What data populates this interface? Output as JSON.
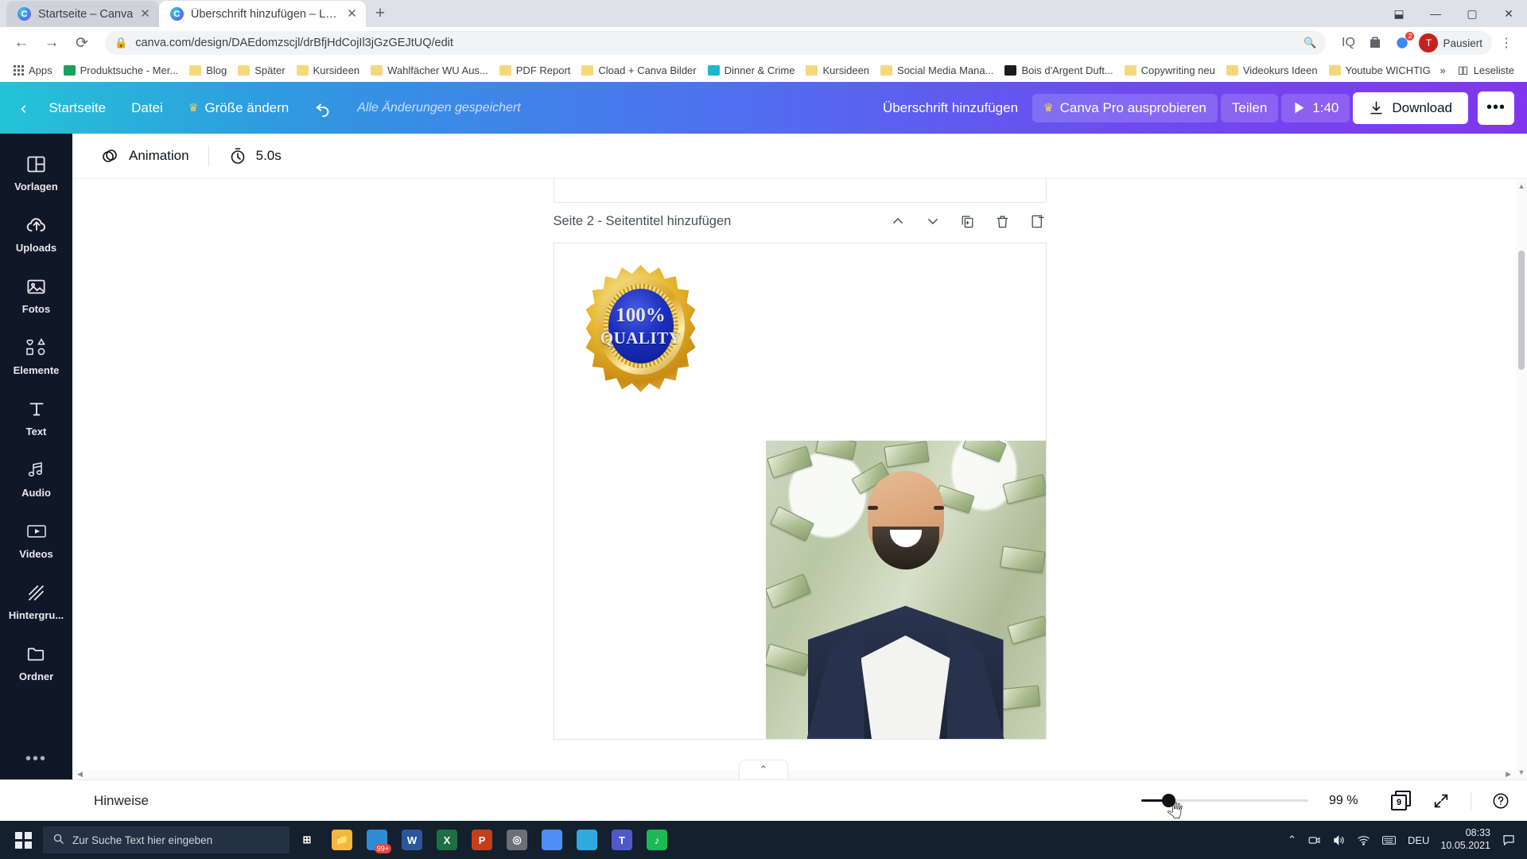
{
  "browser": {
    "tabs": [
      {
        "title": "Startseite – Canva",
        "active": false,
        "favicon": "canva-icon"
      },
      {
        "title": "Überschrift hinzufügen – Logo",
        "active": true,
        "favicon": "canva-icon"
      }
    ],
    "new_tab_label": "+",
    "window_controls": {
      "minimize": "—",
      "maximize": "▢",
      "close": "✕",
      "restore": "⬓"
    },
    "nav": {
      "back": "←",
      "forward": "→",
      "reload": "⟳"
    },
    "omnibox": {
      "url": "canva.com/design/DAEdomzscjl/drBfjHdCojIl3jGzGEJtUQ/edit",
      "lock": "lock-icon",
      "zoom_icon": "search-plus-icon"
    },
    "toolbar_right": {
      "iq_label": "IQ",
      "ext_badge": "2",
      "profile_label": "Pausiert",
      "profile_initial": "T",
      "menu": "⋮"
    },
    "bookmarks": [
      {
        "label": "Apps",
        "icon": "apps-grid-icon"
      },
      {
        "label": "Produktsuche - Mer...",
        "icon": "green-folder-icon"
      },
      {
        "label": "Blog",
        "icon": "folder-icon"
      },
      {
        "label": "Später",
        "icon": "folder-icon"
      },
      {
        "label": "Kursideen",
        "icon": "folder-icon"
      },
      {
        "label": "Wahlfächer WU Aus...",
        "icon": "folder-icon"
      },
      {
        "label": "PDF Report",
        "icon": "folder-icon"
      },
      {
        "label": "Cload + Canva Bilder",
        "icon": "folder-icon"
      },
      {
        "label": "Dinner & Crime",
        "icon": "teal-site-icon"
      },
      {
        "label": "Kursideen",
        "icon": "folder-icon"
      },
      {
        "label": "Social Media Mana...",
        "icon": "folder-icon"
      },
      {
        "label": "Bois d'Argent Duft...",
        "icon": "dark-site-icon"
      },
      {
        "label": "Copywriting neu",
        "icon": "folder-icon"
      },
      {
        "label": "Videokurs Ideen",
        "icon": "folder-icon"
      },
      {
        "label": "Youtube WICHTIG",
        "icon": "folder-icon"
      }
    ],
    "bookmarks_overflow": "»",
    "reading_list": "Leseliste"
  },
  "canva_header": {
    "back": "‹",
    "home": "Startseite",
    "file": "Datei",
    "resize": "Größe ändern",
    "undo": "undo-icon",
    "saved_status": "Alle Änderungen gespeichert",
    "add_heading": "Überschrift hinzufügen",
    "try_pro": "Canva Pro ausprobieren",
    "share": "Teilen",
    "play_duration": "1:40",
    "download": "Download",
    "more": "•••"
  },
  "subbar": {
    "animation": "Animation",
    "duration": "5.0s"
  },
  "sidebar": {
    "items": [
      {
        "label": "Vorlagen",
        "icon": "templates-icon"
      },
      {
        "label": "Uploads",
        "icon": "upload-cloud-icon"
      },
      {
        "label": "Fotos",
        "icon": "photo-icon"
      },
      {
        "label": "Elemente",
        "icon": "shapes-icon"
      },
      {
        "label": "Text",
        "icon": "text-icon"
      },
      {
        "label": "Audio",
        "icon": "music-note-icon"
      },
      {
        "label": "Videos",
        "icon": "video-icon"
      },
      {
        "label": "Hintergru...",
        "icon": "background-icon"
      },
      {
        "label": "Ordner",
        "icon": "folder-icon"
      }
    ],
    "more": "•••"
  },
  "canvas": {
    "page_title": "Seite 2 - Seitentitel hinzufügen",
    "actions": [
      {
        "name": "move-up",
        "glyph": "⌃"
      },
      {
        "name": "move-down",
        "glyph": "⌄"
      },
      {
        "name": "duplicate",
        "glyph": "copy"
      },
      {
        "name": "delete",
        "glyph": "trash"
      },
      {
        "name": "add-page",
        "glyph": "add"
      }
    ],
    "badge": {
      "top_text": "100%",
      "bottom_text": "QUALITY"
    },
    "collapse": "⌃"
  },
  "bottombar": {
    "notes_label": "Hinweise",
    "zoom_value": "99 %",
    "pages_count": "9",
    "fullscreen": "expand-icon",
    "help": "?"
  },
  "taskbar": {
    "search_placeholder": "Zur Suche Text hier eingeben",
    "apps": [
      {
        "name": "task-view",
        "label": "⊞",
        "color": "#14202e"
      },
      {
        "name": "explorer",
        "label": "📁",
        "color": "#f3b83d"
      },
      {
        "name": "store",
        "label": "",
        "color": "#2e8bd6",
        "badge": "99+"
      },
      {
        "name": "word",
        "label": "W",
        "color": "#2b579a"
      },
      {
        "name": "excel",
        "label": "X",
        "color": "#1d7044"
      },
      {
        "name": "powerpoint",
        "label": "P",
        "color": "#c43e1c"
      },
      {
        "name": "media",
        "label": "◎",
        "color": "#6b6f76"
      },
      {
        "name": "chrome",
        "label": "",
        "color": "#4f8ef7"
      },
      {
        "name": "edge",
        "label": "",
        "color": "#30a8e0"
      },
      {
        "name": "teams",
        "label": "T",
        "color": "#5059c9"
      },
      {
        "name": "spotify",
        "label": "♪",
        "color": "#1db954"
      }
    ],
    "tray": {
      "chevron": "⌃",
      "camera": "camera-icon",
      "volume": "volume-icon",
      "network": "wifi-icon",
      "keyboard": "keyboard-icon",
      "language": "DEU",
      "time": "08:33",
      "date": "10.05.2021",
      "action_center": "notification-icon"
    }
  },
  "colors": {
    "canva_gradient_start": "#23c4d6",
    "canva_gradient_end": "#8136ef",
    "rail_bg": "#101827",
    "taskbar_bg": "#14202e",
    "badge_blue": "#1b2fbf",
    "badge_gold": "#e8b830"
  }
}
